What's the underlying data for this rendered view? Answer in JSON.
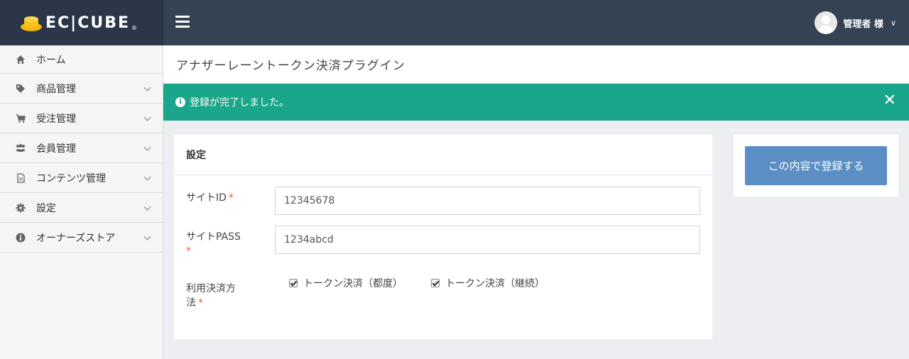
{
  "header": {
    "logo_text": "EC|CUBE",
    "logo_reg": "®",
    "user_name": "管理者 様",
    "user_chevron": "∨"
  },
  "sidebar": {
    "items": [
      {
        "label": "ホーム",
        "icon": "home-icon",
        "glyph": "⌂"
      },
      {
        "label": "商品管理",
        "icon": "tag-icon",
        "glyph": "◆"
      },
      {
        "label": "受注管理",
        "icon": "cart-icon",
        "glyph": "▬"
      },
      {
        "label": "会員管理",
        "icon": "users-icon",
        "glyph": "●"
      },
      {
        "label": "コンテンツ管理",
        "icon": "document-icon",
        "glyph": "▤"
      },
      {
        "label": "設定",
        "icon": "gear-icon",
        "glyph": "✱"
      },
      {
        "label": "オーナーズストア",
        "icon": "info-icon",
        "glyph": "i"
      }
    ]
  },
  "page": {
    "title": "アナザーレーントークン決済プラグイン"
  },
  "alert": {
    "icon_glyph": "i",
    "message": "登録が完了しました。",
    "close": "✕"
  },
  "card": {
    "title": "設定",
    "fields": {
      "site_id_label": "サイトID",
      "site_id_value": "12345678",
      "site_pass_label": "サイトPASS",
      "site_pass_value": "1234abcd",
      "method_label_line1": "利用決済方",
      "method_label_line2": "法",
      "required_mark": "*"
    },
    "checkboxes": [
      {
        "label": "トークン決済（都度）",
        "checked": true
      },
      {
        "label": "トークン決済（継続）",
        "checked": true
      }
    ]
  },
  "submit": {
    "label": "この内容で登録する"
  },
  "colors": {
    "header": "#344253",
    "alert": "#19a68a",
    "button": "#5b8ec4"
  }
}
